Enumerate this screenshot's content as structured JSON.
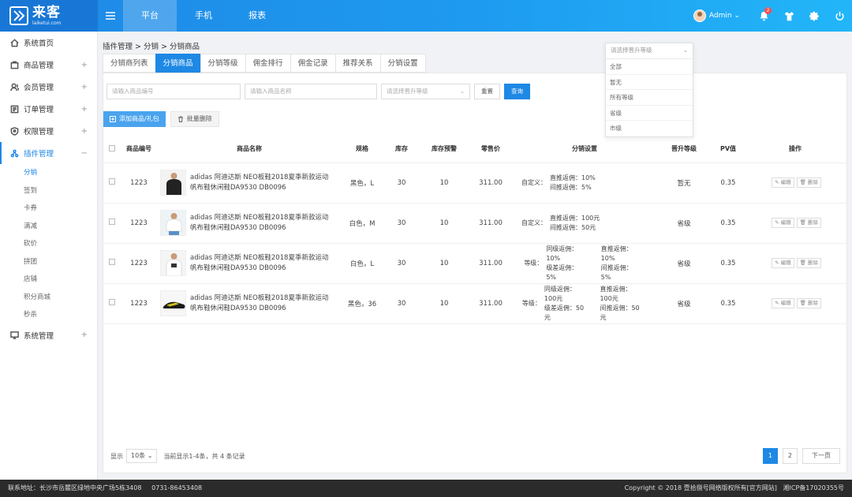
{
  "brand": {
    "name_cn": "来客",
    "name_en": "laiketui.com"
  },
  "topnav": [
    {
      "label": "平台",
      "active": true
    },
    {
      "label": "手机"
    },
    {
      "label": "报表"
    }
  ],
  "user": {
    "name": "Admin",
    "notifications": "2"
  },
  "sidebar": [
    {
      "label": "系统首页",
      "icon": "home-icon",
      "plus": ""
    },
    {
      "label": "商品管理",
      "icon": "goods-icon",
      "plus": "+"
    },
    {
      "label": "会员管理",
      "icon": "member-icon",
      "plus": "+"
    },
    {
      "label": "订单管理",
      "icon": "order-icon",
      "plus": "+"
    },
    {
      "label": "权限管理",
      "icon": "permission-icon",
      "plus": "+"
    },
    {
      "label": "插件管理",
      "icon": "plugin-icon",
      "plus": "−",
      "open": true
    },
    {
      "label": "系统管理",
      "icon": "system-icon",
      "plus": "+"
    }
  ],
  "submenu": [
    "分销",
    "签到",
    "卡券",
    "满减",
    "砍价",
    "拼团",
    "店铺",
    "积分商城",
    "秒杀"
  ],
  "breadcrumb": "插件管理 > 分销 > 分销商品",
  "tabs": [
    "分销商列表",
    "分销商品",
    "分销等级",
    "佣金排行",
    "佣金记录",
    "推荐关系",
    "分销设置"
  ],
  "filters": {
    "code_placeholder": "请输入商品编号",
    "name_placeholder": "请输入商品名称",
    "level_placeholder": "请选择晋升等级",
    "reset": "重置",
    "search": "查询"
  },
  "actions": {
    "add": "添加商品/礼包",
    "batch_delete": "批量删除"
  },
  "table": {
    "headers": [
      "商品编号",
      "商品名称",
      "规格",
      "库存",
      "库存预警",
      "零售价",
      "分销设置",
      "晋升等级",
      "PV值",
      "操作"
    ],
    "edit": "编辑",
    "delete": "删除",
    "rows": [
      {
        "code": "1223",
        "name": "adidas 阿迪达斯 NEO板鞋2018夏季新款运动帆布鞋休闲鞋DA9530 DB0096",
        "spec": "黑色，L",
        "stock": "30",
        "warn": "10",
        "price": "311.00",
        "mode": "自定义：",
        "d1": [
          "直推返佣：10%",
          "间推返佣：5%"
        ],
        "d2": [],
        "level": "暂无",
        "pv": "0.35"
      },
      {
        "code": "1223",
        "name": "adidas 阿迪达斯 NEO板鞋2018夏季新款运动帆布鞋休闲鞋DA9530 DB0096",
        "spec": "白色，M",
        "stock": "30",
        "warn": "10",
        "price": "311.00",
        "mode": "自定义：",
        "d1": [
          "直推返佣：100元",
          "间推返佣：50元"
        ],
        "d2": [],
        "level": "省级",
        "pv": "0.35"
      },
      {
        "code": "1223",
        "name": "adidas 阿迪达斯 NEO板鞋2018夏季新款运动帆布鞋休闲鞋DA9530 DB0096",
        "spec": "白色，L",
        "stock": "30",
        "warn": "10",
        "price": "311.00",
        "mode": "等级：",
        "d1": [
          "同级返佣：10%",
          "级差返佣：5%"
        ],
        "d2": [
          "直推返佣：10%",
          "间推返佣：5%"
        ],
        "level": "省级",
        "pv": "0.35"
      },
      {
        "code": "1223",
        "name": "adidas 阿迪达斯 NEO板鞋2018夏季新款运动帆布鞋休闲鞋DA9530 DB0096",
        "spec": "黑色，36",
        "stock": "30",
        "warn": "10",
        "price": "311.00",
        "mode": "等级：",
        "d1": [
          "同级返佣：100元",
          "级差返佣：50元"
        ],
        "d2": [
          "直推返佣：100元",
          "间推返佣：50元"
        ],
        "level": "省级",
        "pv": "0.35"
      }
    ]
  },
  "pager": {
    "show": "显示",
    "size": "10条",
    "info": "当前显示1-4条，共 4 条记录",
    "pages": [
      "1",
      "2"
    ],
    "next": "下一页"
  },
  "dropdown": {
    "placeholder": "请选择晋升等级",
    "options": [
      "全部",
      "暂无",
      "所有等级",
      "省级",
      "市级"
    ]
  },
  "footer": {
    "left": "联系地址：长沙市岳麓区绿地中央广场5栋3408     0731-86453408",
    "right": "Copyright © 2018 壹拾捌号网络版权所有[官方网站]   湘ICP备17020355号"
  }
}
